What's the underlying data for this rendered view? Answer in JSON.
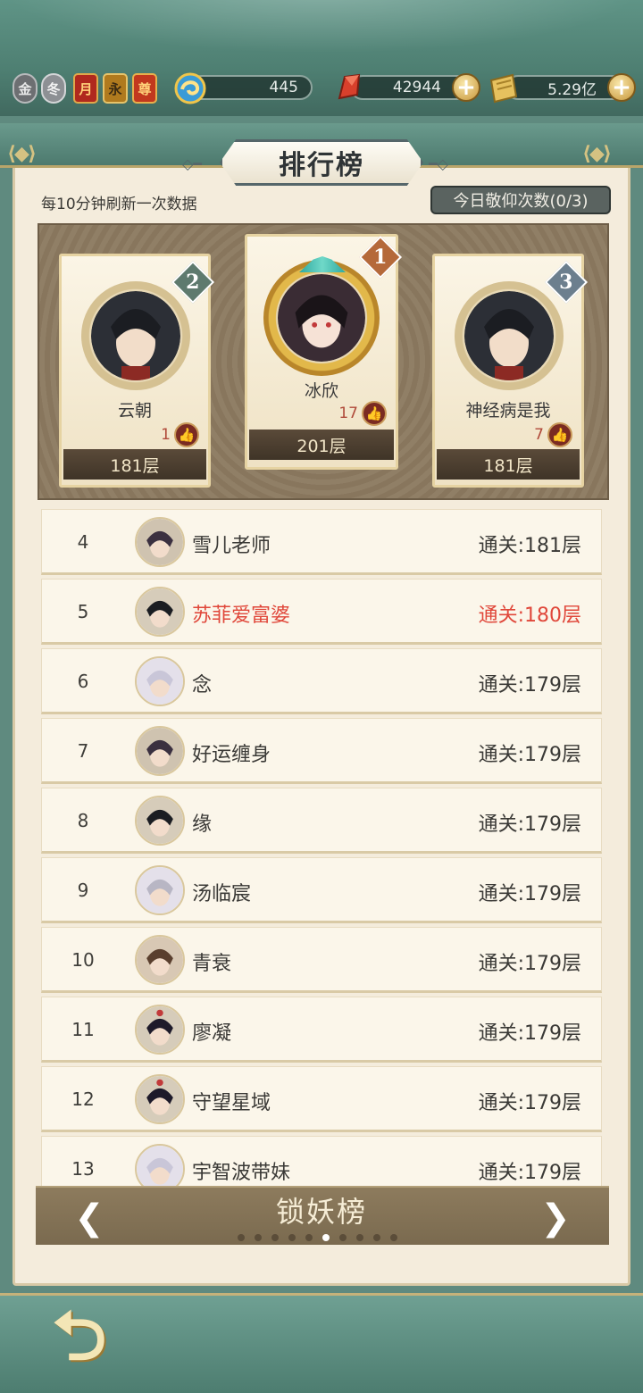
{
  "topbar": {
    "vip_badges": [
      "金",
      "冬",
      "月",
      "永",
      "尊"
    ],
    "resources": [
      {
        "icon": "jade-swirl-icon",
        "value": "445"
      },
      {
        "icon": "red-crystal-icon",
        "value": "42944"
      },
      {
        "icon": "gold-scroll-icon",
        "value": "5.29亿"
      }
    ]
  },
  "panel": {
    "title": "排行榜",
    "refresh_note": "每10分钟刷新一次数据",
    "worship_button": "今日敬仰次数(0/3)"
  },
  "podium": [
    {
      "rank": "2",
      "name": "云朝",
      "likes": "1",
      "floor": "181层"
    },
    {
      "rank": "1",
      "name": "冰欣",
      "likes": "17",
      "floor": "201层"
    },
    {
      "rank": "3",
      "name": "神经病是我",
      "likes": "7",
      "floor": "181层"
    }
  ],
  "list": [
    {
      "rank": "4",
      "name": "雪儿老师",
      "score": "通关:181层"
    },
    {
      "rank": "5",
      "name": "苏菲爱富婆",
      "score": "通关:180层",
      "self": true
    },
    {
      "rank": "6",
      "name": "念",
      "score": "通关:179层"
    },
    {
      "rank": "7",
      "name": "好运缠身",
      "score": "通关:179层"
    },
    {
      "rank": "8",
      "name": "缘",
      "score": "通关:179层"
    },
    {
      "rank": "9",
      "name": "汤临宸",
      "score": "通关:179层"
    },
    {
      "rank": "10",
      "name": "青衰",
      "score": "通关:179层"
    },
    {
      "rank": "11",
      "name": "廖凝",
      "score": "通关:179层"
    },
    {
      "rank": "12",
      "name": "守望星域",
      "score": "通关:179层"
    },
    {
      "rank": "13",
      "name": "宇智波带妹",
      "score": "通关:179层"
    }
  ],
  "nav": {
    "board_name": "锁妖榜",
    "page_count": 10,
    "active_page": 6
  },
  "colors": {
    "self_highlight": "#e0473a",
    "rank1_badge": "#b5693a",
    "rank2_badge": "#5e7a6e",
    "rank3_badge": "#6c7f8e"
  }
}
